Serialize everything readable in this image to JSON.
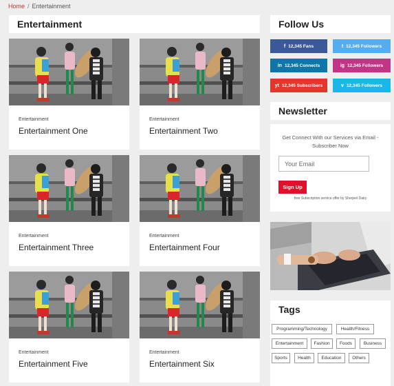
{
  "breadcrumb": {
    "home": "Home",
    "separator": "/",
    "current": "Entertainment"
  },
  "main": {
    "section_title": "Entertainment",
    "posts": [
      {
        "category": "Entertainment",
        "title": "Entertainment One"
      },
      {
        "category": "Entertainment",
        "title": "Entertainment Two"
      },
      {
        "category": "Entertainment",
        "title": "Entertainment Three"
      },
      {
        "category": "Entertainment",
        "title": "Entertainment Four"
      },
      {
        "category": "Entertainment",
        "title": "Entertainment Five"
      },
      {
        "category": "Entertainment",
        "title": "Entertainment Six"
      }
    ]
  },
  "sidebar": {
    "follow": {
      "title": "Follow Us",
      "buttons": [
        {
          "network": "facebook",
          "icon": "f",
          "label": "12,345 Fans",
          "color": "#3b5998"
        },
        {
          "network": "twitter",
          "icon": "t",
          "label": "12,345 Followers",
          "color": "#55acee"
        },
        {
          "network": "linkedin",
          "icon": "in",
          "label": "12,345 Connects",
          "color": "#0e76a8"
        },
        {
          "network": "instagram",
          "icon": "ig",
          "label": "12,345 Followers",
          "color": "#c13584"
        },
        {
          "network": "youtube",
          "icon": "yt",
          "label": "12,345 Subscribers",
          "color": "#e5352b"
        },
        {
          "network": "vimeo",
          "icon": "v",
          "label": "12,345 Followers",
          "color": "#1ab7ea"
        }
      ]
    },
    "newsletter": {
      "title": "Newsletter",
      "description": "Get Connect With our Services via Email - Subscriber Now",
      "placeholder": "Your Email",
      "button": "Sign Up",
      "footnote": "free Subscription service offer by Sherjeel Dairy"
    },
    "tags": {
      "title": "Tags",
      "items": [
        "Programming/Technology",
        "Health/Fitness",
        "Entertainment",
        "Fashion",
        "Foods",
        "Business",
        "Sports",
        "Health",
        "Education",
        "Others"
      ]
    }
  },
  "colors": {
    "accent": "#e0102a",
    "background": "#eeeeee",
    "link": "#d32f2f"
  }
}
